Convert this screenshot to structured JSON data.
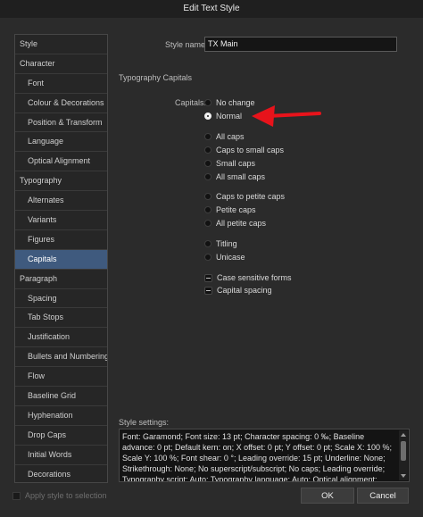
{
  "window": {
    "title": "Edit Text Style"
  },
  "sidebar": {
    "items": [
      {
        "label": "Style",
        "level": 0
      },
      {
        "label": "Character",
        "level": 0
      },
      {
        "label": "Font",
        "level": 1
      },
      {
        "label": "Colour & Decorations",
        "level": 1
      },
      {
        "label": "Position & Transform",
        "level": 1
      },
      {
        "label": "Language",
        "level": 1
      },
      {
        "label": "Optical Alignment",
        "level": 1
      },
      {
        "label": "Typography",
        "level": 0
      },
      {
        "label": "Alternates",
        "level": 1
      },
      {
        "label": "Variants",
        "level": 1
      },
      {
        "label": "Figures",
        "level": 1
      },
      {
        "label": "Capitals",
        "level": 1,
        "active": true
      },
      {
        "label": "Paragraph",
        "level": 0
      },
      {
        "label": "Spacing",
        "level": 1
      },
      {
        "label": "Tab Stops",
        "level": 1
      },
      {
        "label": "Justification",
        "level": 1
      },
      {
        "label": "Bullets and Numbering",
        "level": 1
      },
      {
        "label": "Flow",
        "level": 1
      },
      {
        "label": "Baseline Grid",
        "level": 1
      },
      {
        "label": "Hyphenation",
        "level": 1
      },
      {
        "label": "Drop Caps",
        "level": 1
      },
      {
        "label": "Initial Words",
        "level": 1
      },
      {
        "label": "Decorations",
        "level": 1
      }
    ]
  },
  "main": {
    "style_name_label": "Style name:",
    "style_name_value": "TX Main",
    "section_title": "Typography Capitals",
    "capitals_label": "Capitals:",
    "options": [
      {
        "label": "No change",
        "selected": false
      },
      {
        "label": "Normal",
        "selected": true
      },
      {
        "label": "All caps",
        "selected": false
      },
      {
        "label": "Caps to small caps",
        "selected": false
      },
      {
        "label": "Small caps",
        "selected": false
      },
      {
        "label": "All small caps",
        "selected": false
      },
      {
        "label": "Caps to petite caps",
        "selected": false
      },
      {
        "label": "Petite caps",
        "selected": false
      },
      {
        "label": "All petite caps",
        "selected": false
      },
      {
        "label": "Titling",
        "selected": false
      },
      {
        "label": "Unicase",
        "selected": false
      }
    ],
    "checkboxes": [
      {
        "label": "Case sensitive forms",
        "state": "mixed"
      },
      {
        "label": "Capital spacing",
        "state": "mixed"
      }
    ],
    "style_settings_label": "Style settings:",
    "style_settings_text": "Font: Garamond; Font size: 13 pt; Character spacing: 0 ‰; Baseline advance: 0 pt; Default kern: on; X offset: 0 pt; Y offset: 0 pt; Scale X: 100 %; Scale Y: 100 %; Font shear: 0 °; Leading override: 15 pt; Underline: None; Strikethrough: None; No superscript/subscript; No caps; Leading override; Typography script: Auto; Typography language: Auto; Optical alignment: None; No break: off; Spelling"
  },
  "footer": {
    "apply_label": "Apply style to selection",
    "ok_label": "OK",
    "cancel_label": "Cancel"
  },
  "colors": {
    "accent": "#3f5a7e",
    "annotation_arrow": "#e8131b"
  }
}
